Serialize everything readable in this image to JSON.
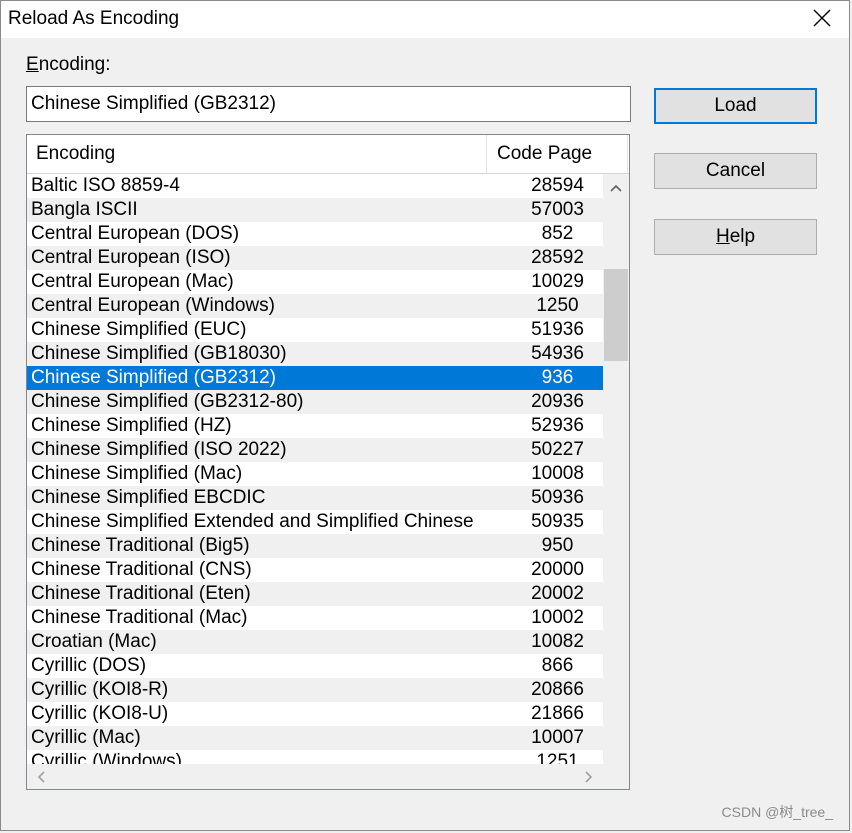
{
  "window": {
    "title": "Reload As Encoding",
    "close_icon": "close-icon"
  },
  "encoding_field": {
    "label_accel": "E",
    "label_rest": "ncoding:",
    "value": "Chinese Simplified (GB2312)"
  },
  "buttons": {
    "load": "Load",
    "cancel": "Cancel",
    "help_accel": "H",
    "help_rest": "elp"
  },
  "list": {
    "columns": [
      "Encoding",
      "Code Page"
    ],
    "selected_index": 8,
    "rows": [
      [
        "Baltic ISO 8859-4",
        "28594"
      ],
      [
        "Bangla ISCII",
        "57003"
      ],
      [
        "Central European (DOS)",
        "852"
      ],
      [
        "Central European (ISO)",
        "28592"
      ],
      [
        "Central European (Mac)",
        "10029"
      ],
      [
        "Central European (Windows)",
        "1250"
      ],
      [
        "Chinese Simplified (EUC)",
        "51936"
      ],
      [
        "Chinese Simplified (GB18030)",
        "54936"
      ],
      [
        "Chinese Simplified (GB2312)",
        "936"
      ],
      [
        "Chinese Simplified (GB2312-80)",
        "20936"
      ],
      [
        "Chinese Simplified (HZ)",
        "52936"
      ],
      [
        "Chinese Simplified (ISO 2022)",
        "50227"
      ],
      [
        "Chinese Simplified (Mac)",
        "10008"
      ],
      [
        "Chinese Simplified EBCDIC",
        "50936"
      ],
      [
        "Chinese Simplified Extended and Simplified Chinese",
        "50935"
      ],
      [
        "Chinese Traditional (Big5)",
        "950"
      ],
      [
        "Chinese Traditional (CNS)",
        "20000"
      ],
      [
        "Chinese Traditional (Eten)",
        "20002"
      ],
      [
        "Chinese Traditional (Mac)",
        "10002"
      ],
      [
        "Croatian (Mac)",
        "10082"
      ],
      [
        "Cyrillic (DOS)",
        "866"
      ],
      [
        "Cyrillic (KOI8-R)",
        "20866"
      ],
      [
        "Cyrillic (KOI8-U)",
        "21866"
      ],
      [
        "Cyrillic (Mac)",
        "10007"
      ],
      [
        "Cyrillic (Windows)",
        "1251"
      ]
    ]
  },
  "watermark": "CSDN @树_tree_",
  "colors": {
    "selection": "#0078d7",
    "default_button_border": "#0078d7"
  }
}
